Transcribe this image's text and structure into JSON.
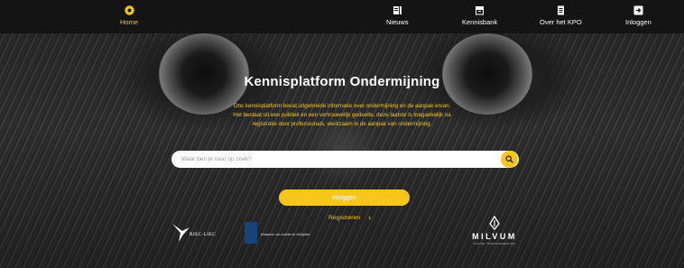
{
  "nav": {
    "items": [
      {
        "label": "Home",
        "icon": "home-circle-icon",
        "active": true
      },
      {
        "label": "Nieuws",
        "icon": "newspaper-icon"
      },
      {
        "label": "Kennisbank",
        "icon": "archive-icon"
      },
      {
        "label": "Over het KPO",
        "icon": "document-icon"
      },
      {
        "label": "Inloggen",
        "icon": "login-icon"
      }
    ]
  },
  "hero": {
    "title": "Kennisplatform Ondermijning",
    "intro_lines": [
      "Ons kennisplatform bevat uitgebreide informatie over ondermijning en de aanpak ervan.",
      "Het bestaat uit een publiek en een vertrouwelijk gedeelte, deze laatste is toegankelijk na",
      "registratie door professionals, werkzaam in de aanpak van ondermijning."
    ]
  },
  "search": {
    "placeholder": "Waar ben je naar op zoek?",
    "value": ""
  },
  "actions": {
    "login_label": "Inloggen",
    "register_label": "Registreren",
    "register_chevron": "›"
  },
  "logos": {
    "riec": "RIEC-LIEC",
    "mjv": "Ministerie van Justitie en Veiligheid",
    "milvum": "MILVUM",
    "milvum_sub": "DIGITAL TRANSFORMATION"
  },
  "colors": {
    "accent": "#f7c61a",
    "nav_bg": "#141414",
    "text": "#ffffff"
  }
}
